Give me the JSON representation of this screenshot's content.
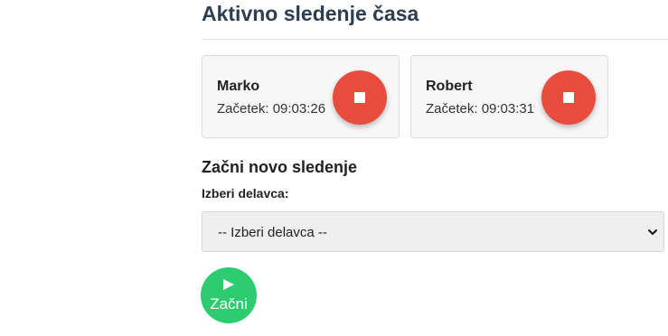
{
  "header": {
    "title": "Aktivno sledenje časa"
  },
  "active_sessions": [
    {
      "name": "Marko",
      "start": "Začetek: 09:03:26",
      "stop_icon": "stop-icon"
    },
    {
      "name": "Robert",
      "start": "Začetek: 09:03:31",
      "stop_icon": "stop-icon"
    }
  ],
  "new_tracking": {
    "title": "Začni novo sledenje",
    "worker_label": "Izberi delavca:",
    "worker_select": {
      "selected": "-- Izberi delavca --"
    },
    "start_button": {
      "icon": "play-icon",
      "label": "Začni"
    }
  },
  "colors": {
    "title": "#2c3e50",
    "stop": "#e74c3c",
    "start": "#2ecc71",
    "card_bg": "#f7f7f7"
  }
}
